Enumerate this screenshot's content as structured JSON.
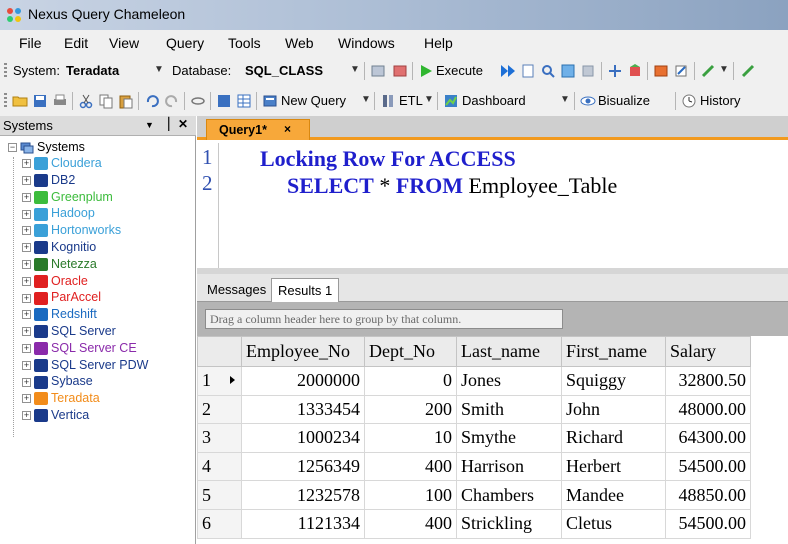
{
  "window": {
    "title": "Nexus Query Chameleon"
  },
  "menu": [
    "File",
    "Edit",
    "View",
    "Query",
    "Tools",
    "Web",
    "Windows",
    "Help"
  ],
  "toolbar1": {
    "system_label": "System:",
    "system_value": "Teradata",
    "database_label": "Database:",
    "database_value": "SQL_CLASS",
    "execute_label": "Execute"
  },
  "toolbar2": {
    "new_query_label": "New Query",
    "etl_label": "ETL",
    "dashboard_label": "Dashboard",
    "bisualize_label": "Bisualize",
    "history_label": "History"
  },
  "systems_panel": {
    "header": "Systems",
    "pin_glyph": "▕",
    "close_glyph": "✕",
    "root_label": "Systems",
    "items": [
      {
        "label": "Cloudera",
        "color": "#3aa0d8",
        "icon": "cloudera-folder-icon"
      },
      {
        "label": "DB2",
        "color": "#1a3a8a",
        "icon": "db2-icon"
      },
      {
        "label": "Greenplum",
        "color": "#3cbc3c",
        "icon": "greenplum-icon"
      },
      {
        "label": "Hadoop",
        "color": "#3aa0d8",
        "icon": "hadoop-folder-icon"
      },
      {
        "label": "Hortonworks",
        "color": "#3aa0d8",
        "icon": "hortonworks-folder-icon"
      },
      {
        "label": "Kognitio",
        "color": "#1a3a8a",
        "icon": "kognitio-icon"
      },
      {
        "label": "Netezza",
        "color": "#2a7a2a",
        "icon": "netezza-icon"
      },
      {
        "label": "Oracle",
        "color": "#e02020",
        "icon": "oracle-icon"
      },
      {
        "label": "ParAccel",
        "color": "#e02020",
        "icon": "paraccel-icon"
      },
      {
        "label": "Redshift",
        "color": "#1a6ac0",
        "icon": "redshift-icon"
      },
      {
        "label": "SQL Server",
        "color": "#1a3a8a",
        "icon": "sqlserver-icon"
      },
      {
        "label": "SQL Server CE",
        "color": "#8a2aaa",
        "icon": "sqlserver-ce-icon"
      },
      {
        "label": "SQL Server PDW",
        "color": "#1a3a8a",
        "icon": "sqlserver-pdw-icon"
      },
      {
        "label": "Sybase",
        "color": "#1a3a8a",
        "icon": "sybase-icon"
      },
      {
        "label": "Teradata",
        "color": "#f28c1a",
        "icon": "teradata-icon"
      },
      {
        "label": "Vertica",
        "color": "#1a3a8a",
        "icon": "vertica-icon"
      }
    ]
  },
  "editor": {
    "tab_label": "Query1*",
    "tab_close": "×",
    "line_numbers": [
      "1",
      "2"
    ],
    "line1": {
      "kw": "Locking Row For ACCESS"
    },
    "line2": {
      "kw1": "SELECT",
      "star": " * ",
      "kw2": "FROM",
      "rest": " Employee_Table"
    }
  },
  "results": {
    "tabs": [
      "Messages",
      "Results 1"
    ],
    "group_hint": "Drag a column header here to group by that column.",
    "columns": [
      "Employee_No",
      "Dept_No",
      "Last_name",
      "First_name",
      "Salary"
    ],
    "rows": [
      {
        "n": "1",
        "emp": "2000000",
        "dept": "0",
        "last": "Jones",
        "first": "Squiggy",
        "sal": "32800.50"
      },
      {
        "n": "2",
        "emp": "1333454",
        "dept": "200",
        "last": "Smith",
        "first": "John",
        "sal": "48000.00"
      },
      {
        "n": "3",
        "emp": "1000234",
        "dept": "10",
        "last": "Smythe",
        "first": "Richard",
        "sal": "64300.00"
      },
      {
        "n": "4",
        "emp": "1256349",
        "dept": "400",
        "last": "Harrison",
        "first": "Herbert",
        "sal": "54500.00"
      },
      {
        "n": "5",
        "emp": "1232578",
        "dept": "100",
        "last": "Chambers",
        "first": "Mandee",
        "sal": "48850.00"
      },
      {
        "n": "6",
        "emp": "1121334",
        "dept": "400",
        "last": "Strickling",
        "first": "Cletus",
        "sal": "54500.00"
      }
    ]
  }
}
